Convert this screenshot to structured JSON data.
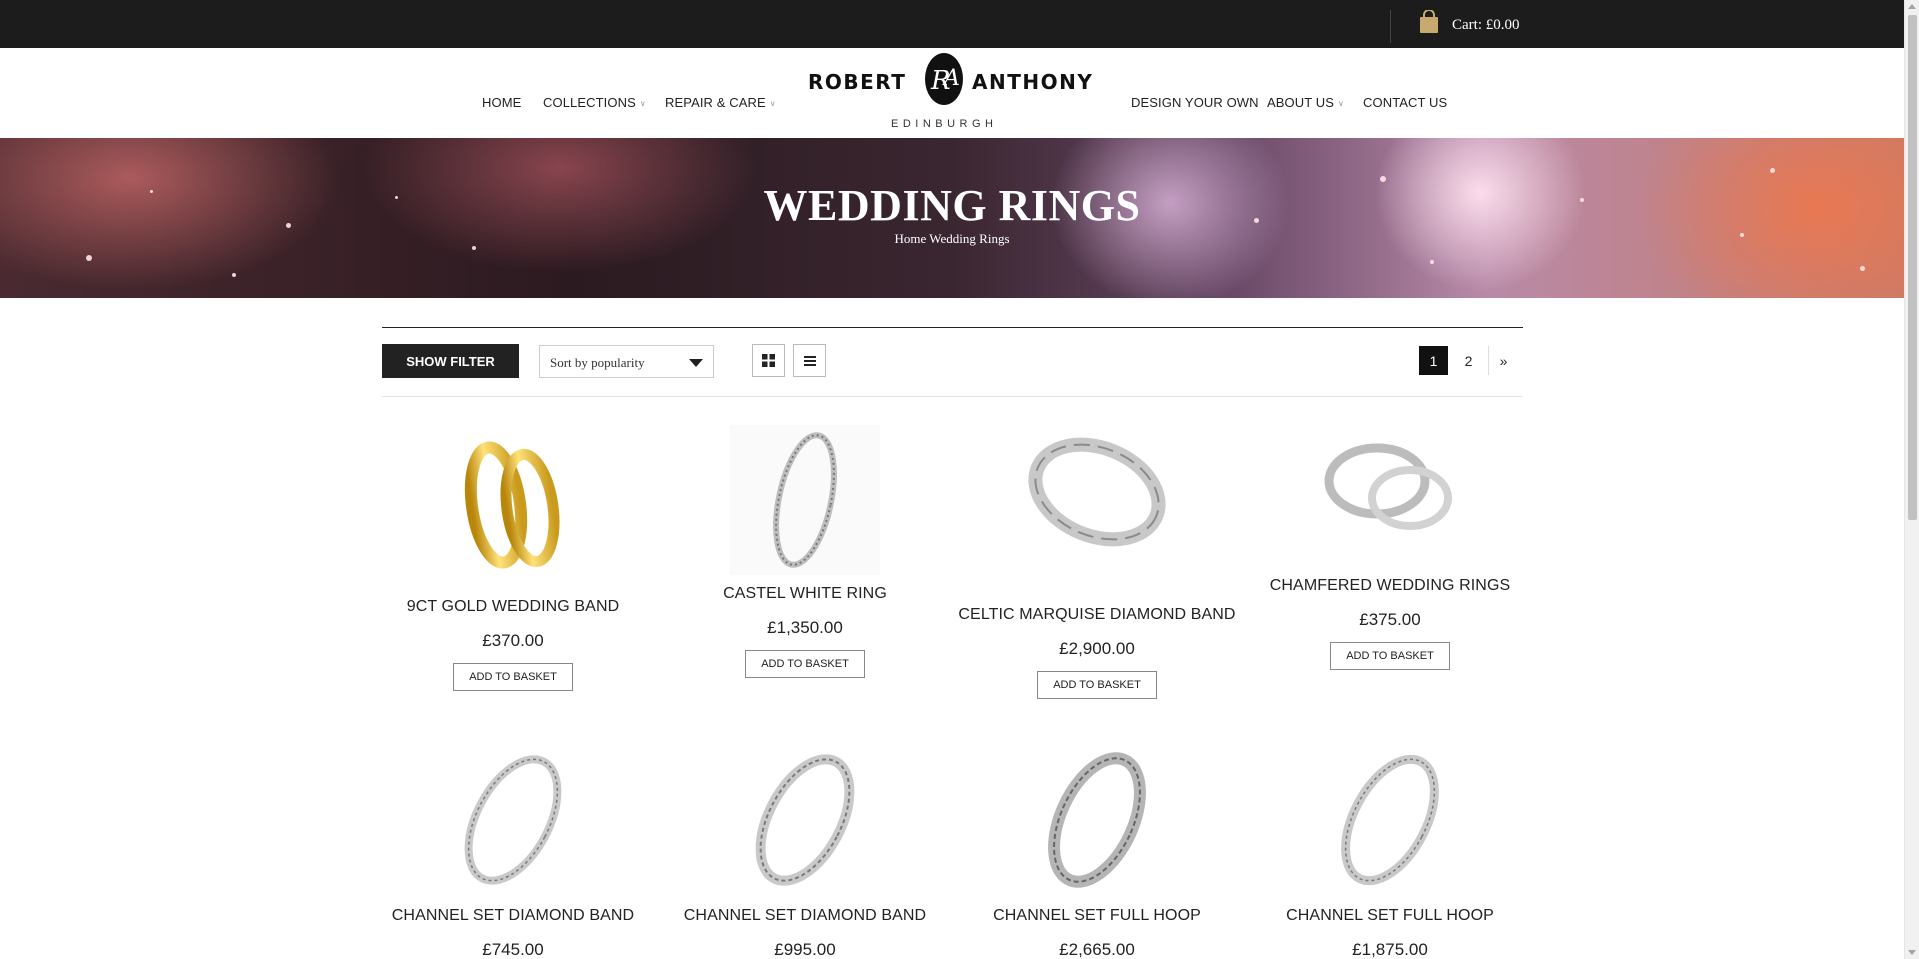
{
  "topbar": {
    "cart_label": "Cart: £0.00",
    "cart_icon": "shopping-bag-icon",
    "accent": "#c9a96e"
  },
  "brand": {
    "name_left": "ROBERT",
    "name_right": "ANTHONY",
    "monogram": "RA",
    "city": "EDINBURGH"
  },
  "nav": {
    "home": "HOME",
    "collections": "COLLECTIONS",
    "repair": "REPAIR & CARE",
    "design": "DESIGN YOUR OWN",
    "about": "ABOUT US",
    "contact": "CONTACT US",
    "dropdown_icon": "chevron-down-icon"
  },
  "hero": {
    "title": "WEDDING RINGS",
    "crumb_home": "Home",
    "crumb_current": "Wedding Rings"
  },
  "toolbar": {
    "filter_label": "SHOW FILTER",
    "sort_value": "Sort by popularity",
    "grid_icon": "grid-view-icon",
    "list_icon": "list-view-icon",
    "pages": [
      "1",
      "2"
    ],
    "current_page": "1",
    "next_label": "»"
  },
  "products": [
    {
      "name": "9CT GOLD WEDDING BAND",
      "price": "£370.00",
      "button": "ADD TO BASKET",
      "image": "gold-ring-pair"
    },
    {
      "name": "CASTEL WHITE RING",
      "price": "£1,350.00",
      "button": "ADD TO BASKET",
      "image": "eternity-ring"
    },
    {
      "name": "CELTIC MARQUISE DIAMOND BAND",
      "price": "£2,900.00",
      "button": "ADD TO BASKET",
      "image": "marquise-band"
    },
    {
      "name": "CHAMFERED WEDDING RINGS",
      "price": "£375.00",
      "button": "ADD TO BASKET",
      "image": "silver-ring-pair"
    },
    {
      "name": "CHANNEL SET DIAMOND BAND",
      "price": "£745.00",
      "image": "channel-band"
    },
    {
      "name": "CHANNEL SET DIAMOND BAND",
      "price": "£995.00",
      "image": "channel-band"
    },
    {
      "name": "CHANNEL SET FULL HOOP",
      "price": "£2,665.00",
      "image": "channel-hoop"
    },
    {
      "name": "CHANNEL SET FULL HOOP",
      "price": "£1,875.00",
      "image": "channel-hoop"
    }
  ]
}
